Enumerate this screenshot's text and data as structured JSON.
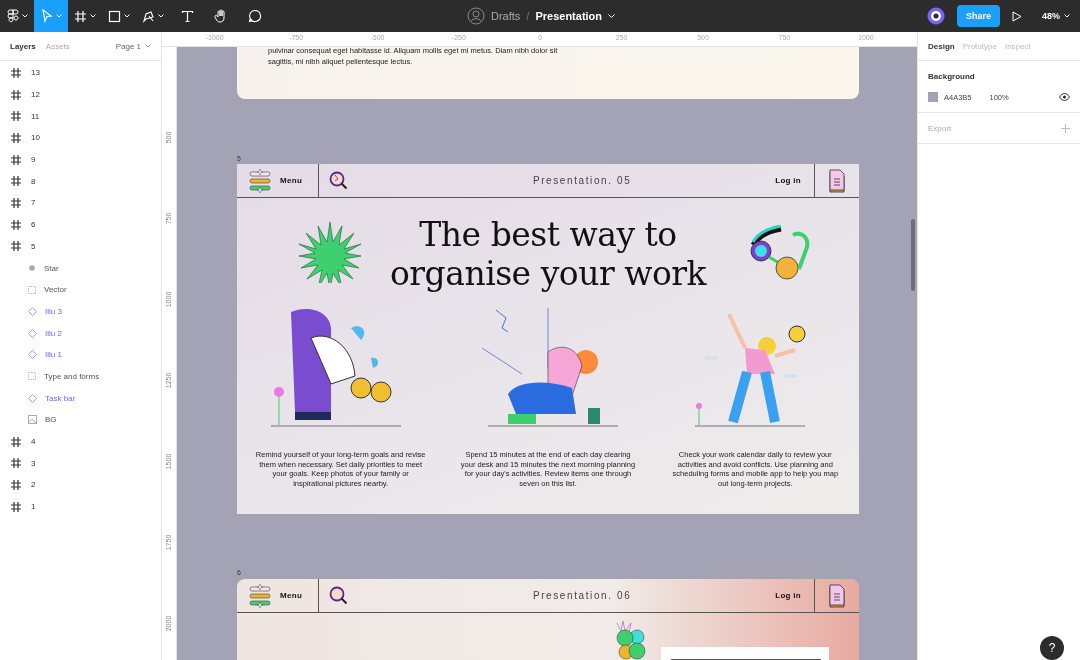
{
  "toolbar": {
    "tools": [
      {
        "kind": "menu",
        "selected": false
      },
      {
        "kind": "move",
        "selected": true
      },
      {
        "kind": "frame",
        "selected": false
      },
      {
        "kind": "shape",
        "selected": false
      },
      {
        "kind": "pen",
        "selected": false
      },
      {
        "kind": "text",
        "selected": false
      },
      {
        "kind": "hand",
        "selected": false
      },
      {
        "kind": "comment",
        "selected": false
      }
    ],
    "folder": "Drafts",
    "separator": "/",
    "file_name": "Presentation",
    "share_button": "Share",
    "zoom": "48%"
  },
  "left_panel": {
    "tabs": [
      {
        "label": "Layers",
        "selected": true
      },
      {
        "label": "Assets",
        "selected": false
      }
    ],
    "page": "Page 1",
    "layers": [
      {
        "name": "13",
        "kind": "frame"
      },
      {
        "name": "12",
        "kind": "frame"
      },
      {
        "name": "11",
        "kind": "frame"
      },
      {
        "name": "10",
        "kind": "frame"
      },
      {
        "name": "9",
        "kind": "frame"
      },
      {
        "name": "8",
        "kind": "frame"
      },
      {
        "name": "7",
        "kind": "frame"
      },
      {
        "name": "6",
        "kind": "frame"
      },
      {
        "name": "5",
        "kind": "frame",
        "children": [
          {
            "name": "Star",
            "kind": "star"
          },
          {
            "name": "Vector",
            "kind": "vector"
          },
          {
            "name": "Illu 3",
            "kind": "component"
          },
          {
            "name": "Illu 2",
            "kind": "component"
          },
          {
            "name": "Illu 1",
            "kind": "component"
          },
          {
            "name": "Type and forms",
            "kind": "vector"
          },
          {
            "name": "Task bar",
            "kind": "component"
          },
          {
            "name": "BG",
            "kind": "image"
          }
        ]
      },
      {
        "name": "4",
        "kind": "frame"
      },
      {
        "name": "3",
        "kind": "frame"
      },
      {
        "name": "2",
        "kind": "frame"
      },
      {
        "name": "1",
        "kind": "frame"
      }
    ]
  },
  "rulers": {
    "horizontal": [
      "-1000",
      "-750",
      "-500",
      "-250",
      "0",
      "250",
      "500",
      "750",
      "1000"
    ],
    "vertical": [
      "500",
      "750",
      "1000",
      "1250",
      "1500",
      "1750",
      "2000"
    ]
  },
  "canvas": {
    "top_frame": {
      "lines": [
        "pulvinar consequat eget habitasse id. Aliquam mollis eget mi metus. Diam nibh dolor sit",
        "sagittis, mi nibh aliquet pellentesque lectus."
      ]
    },
    "frame_5": {
      "label": "5",
      "menu": "Menu",
      "title": "Presentation. 05",
      "login": "Log in",
      "headline": "The best way to organise your work",
      "captions": [
        "Remind yourself of your long-term goals and revise them when necessary.  Set daily priorities to meet your goals.  Keep photos of your family or inspirational pictures nearby.",
        "Spend 15 minutes at the end of each day clearing your desk and 15 minutes the next morning planning for your day's activities. Review items one through seven on this list.",
        "Check your work calendar daily to review your activities and avoid conflicts.  Use planning and scheduling forms and mobile app to help you map out long-term projects."
      ]
    },
    "frame_6": {
      "label": "6",
      "menu": "Menu",
      "title": "Presentation. 06",
      "login": "Log in"
    }
  },
  "right_panel": {
    "tabs": [
      {
        "label": "Design",
        "selected": true
      },
      {
        "label": "Prototype",
        "selected": false
      },
      {
        "label": "Inspect",
        "selected": false
      }
    ],
    "background_label": "Background",
    "fill": {
      "color": "#a4a3b5",
      "hex": "A4A3B5",
      "opacity": "100%"
    },
    "export_label": "Export"
  },
  "help_button": "?"
}
